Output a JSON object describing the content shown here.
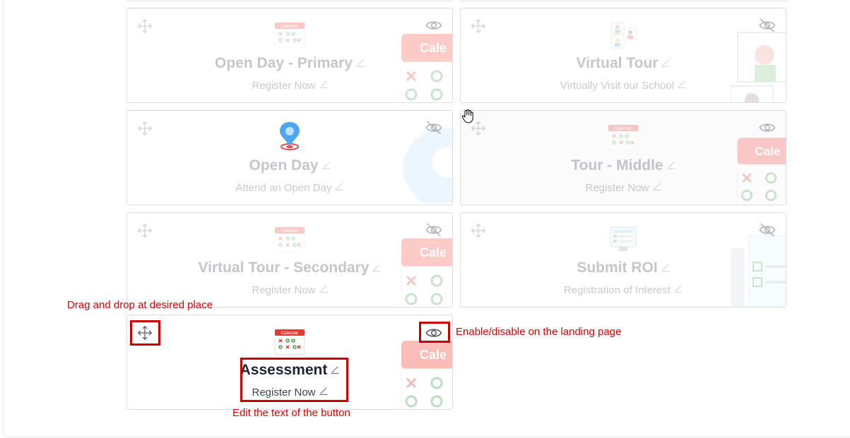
{
  "cards": [
    {
      "title": "Open Day - Primary",
      "subtitle": "Register Now",
      "thumb": "calendar-thumbnail",
      "visibility": "eye-icon",
      "visible": true
    },
    {
      "title": "Virtual Tour",
      "subtitle": "Virtually Visit our School",
      "thumb": "video-call-thumbnail",
      "visibility": "eye-off-icon",
      "visible": false
    },
    {
      "title": "Open Day",
      "subtitle": "Attend an Open Day",
      "thumb": "location-pin-thumbnail",
      "visibility": "eye-off-icon",
      "visible": false
    },
    {
      "title": "Tour - Middle",
      "subtitle": "Register Now",
      "thumb": "calendar-thumbnail",
      "visibility": "eye-icon",
      "visible": true
    },
    {
      "title": "Virtual Tour - Secondary",
      "subtitle": "Register Now",
      "thumb": "calendar-thumbnail",
      "visibility": "eye-off-icon",
      "visible": false
    },
    {
      "title": "Submit ROI",
      "subtitle": "Registration of Interest",
      "thumb": "form-thumbnail",
      "visibility": "eye-off-icon",
      "visible": false
    },
    {
      "title": "Assessment",
      "subtitle": "Register Now",
      "thumb": "calendar-thumbnail",
      "visibility": "eye-icon",
      "visible": true
    }
  ],
  "calendar_label": "Calendar",
  "deco_label": "Cale",
  "annotations": {
    "drag": "Drag and drop at desired place",
    "toggle": "Enable/disable on the landing page",
    "edit": "Edit the text of the button"
  },
  "colors": {
    "annotation": "#e00000",
    "calendar_red": "#e53935",
    "icon_gray": "#6b7280",
    "pin_blue": "#3b9cf2"
  }
}
